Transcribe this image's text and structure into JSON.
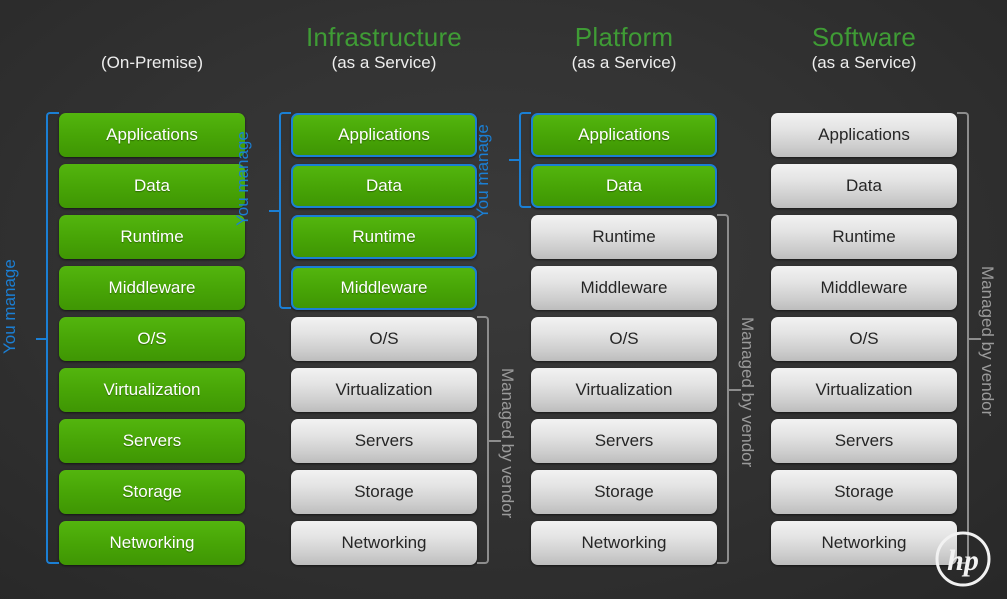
{
  "columns": [
    {
      "id": "on-premise",
      "title_main": "",
      "title_sub": "(On-Premise)",
      "title_main_colored": false,
      "layers": [
        {
          "label": "Applications",
          "style": "green"
        },
        {
          "label": "Data",
          "style": "green"
        },
        {
          "label": "Runtime",
          "style": "green"
        },
        {
          "label": "Middleware",
          "style": "green"
        },
        {
          "label": "O/S",
          "style": "green"
        },
        {
          "label": "Virtualization",
          "style": "green"
        },
        {
          "label": "Servers",
          "style": "green"
        },
        {
          "label": "Storage",
          "style": "green"
        },
        {
          "label": "Networking",
          "style": "green"
        }
      ],
      "you_manage_label": "You manage",
      "you_manage_rows": [
        1,
        9
      ],
      "managed_by_vendor_label": "",
      "managed_by_vendor_rows": []
    },
    {
      "id": "infrastructure-as-a-service",
      "title_main": "Infrastructure",
      "title_sub": "(as a Service)",
      "title_main_colored": true,
      "layers": [
        {
          "label": "Applications",
          "style": "green-ring"
        },
        {
          "label": "Data",
          "style": "green-ring"
        },
        {
          "label": "Runtime",
          "style": "green-ring"
        },
        {
          "label": "Middleware",
          "style": "green-ring"
        },
        {
          "label": "O/S",
          "style": "grey"
        },
        {
          "label": "Virtualization",
          "style": "grey"
        },
        {
          "label": "Servers",
          "style": "grey"
        },
        {
          "label": "Storage",
          "style": "grey"
        },
        {
          "label": "Networking",
          "style": "grey"
        }
      ],
      "you_manage_label": "You manage",
      "you_manage_rows": [
        1,
        4
      ],
      "managed_by_vendor_label": "Managed by vendor",
      "managed_by_vendor_rows": [
        5,
        9
      ]
    },
    {
      "id": "platform-as-a-service",
      "title_main": "Platform",
      "title_sub": "(as a Service)",
      "title_main_colored": true,
      "layers": [
        {
          "label": "Applications",
          "style": "green-ring"
        },
        {
          "label": "Data",
          "style": "green-ring"
        },
        {
          "label": "Runtime",
          "style": "grey"
        },
        {
          "label": "Middleware",
          "style": "grey"
        },
        {
          "label": "O/S",
          "style": "grey"
        },
        {
          "label": "Virtualization",
          "style": "grey"
        },
        {
          "label": "Servers",
          "style": "grey"
        },
        {
          "label": "Storage",
          "style": "grey"
        },
        {
          "label": "Networking",
          "style": "grey"
        }
      ],
      "you_manage_label": "You manage",
      "you_manage_rows": [
        1,
        2
      ],
      "managed_by_vendor_label": "Managed by vendor",
      "managed_by_vendor_rows": [
        3,
        9
      ]
    },
    {
      "id": "software-as-a-service",
      "title_main": "Software",
      "title_sub": "(as a Service)",
      "title_main_colored": true,
      "layers": [
        {
          "label": "Applications",
          "style": "grey"
        },
        {
          "label": "Data",
          "style": "grey"
        },
        {
          "label": "Runtime",
          "style": "grey"
        },
        {
          "label": "Middleware",
          "style": "grey"
        },
        {
          "label": "O/S",
          "style": "grey"
        },
        {
          "label": "Virtualization",
          "style": "grey"
        },
        {
          "label": "Servers",
          "style": "grey"
        },
        {
          "label": "Storage",
          "style": "grey"
        },
        {
          "label": "Networking",
          "style": "grey"
        }
      ],
      "you_manage_label": "",
      "you_manage_rows": [],
      "managed_by_vendor_label": "Managed by vendor",
      "managed_by_vendor_rows": [
        1,
        9
      ]
    }
  ],
  "logo": {
    "name": "hp-logo",
    "text": "hp"
  },
  "colors": {
    "background": "#2b2b2b",
    "green": "#47a406",
    "grey_box": "#e3e3e3",
    "accent_blue": "#1b7fd4",
    "accent_grey": "#8d8d8d",
    "title_green": "#3f9c35",
    "text_light": "#ffffff",
    "text_dark": "#262626"
  }
}
